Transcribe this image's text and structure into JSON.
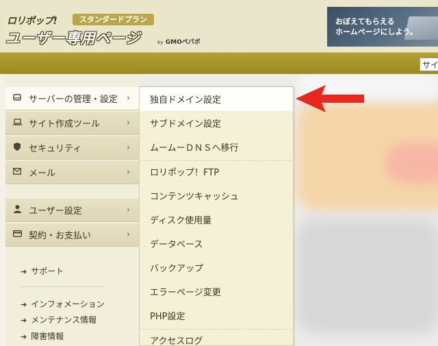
{
  "header": {
    "brand": "ロリポップ!",
    "plan_badge": "スタンダードプラン",
    "title": "ユーザー専用ページ",
    "by": "by",
    "company": "GMOペパボ",
    "promo_text": "おぼえてもらえる\nホームページにしよう。"
  },
  "site_search": {
    "value": "サイ"
  },
  "sidebar": {
    "items": [
      {
        "label": "サーバーの管理・設定",
        "icon": "server-icon",
        "chevron": "›"
      },
      {
        "label": "サイト作成ツール",
        "icon": "laptop-icon",
        "chevron": "›"
      },
      {
        "label": "セキュリティ",
        "icon": "shield-icon",
        "chevron": "›"
      },
      {
        "label": "メール",
        "icon": "mail-icon",
        "chevron": "›"
      },
      {
        "label": "ユーザー設定",
        "icon": "user-icon",
        "chevron": "›"
      },
      {
        "label": "契約・お支払い",
        "icon": "card-icon",
        "chevron": "›"
      }
    ],
    "support": "サポート",
    "links": [
      "インフォメーション",
      "メンテナンス情報",
      "障害情報"
    ]
  },
  "flyout": {
    "items": [
      "独自ドメイン設定",
      "サブドメイン設定",
      "ムームーＤＮＳへ移行",
      "ロリポップ！FTP",
      "コンテンツキャッシュ",
      "ディスク使用量",
      "データベース",
      "バックアップ",
      "エラーページ変更",
      "PHP設定",
      "アクセスログ"
    ]
  },
  "colors": {
    "olive_bar": "#a89628",
    "annotation_arrow": "#e8281e",
    "flyout_bg": "#f5f1d6"
  }
}
